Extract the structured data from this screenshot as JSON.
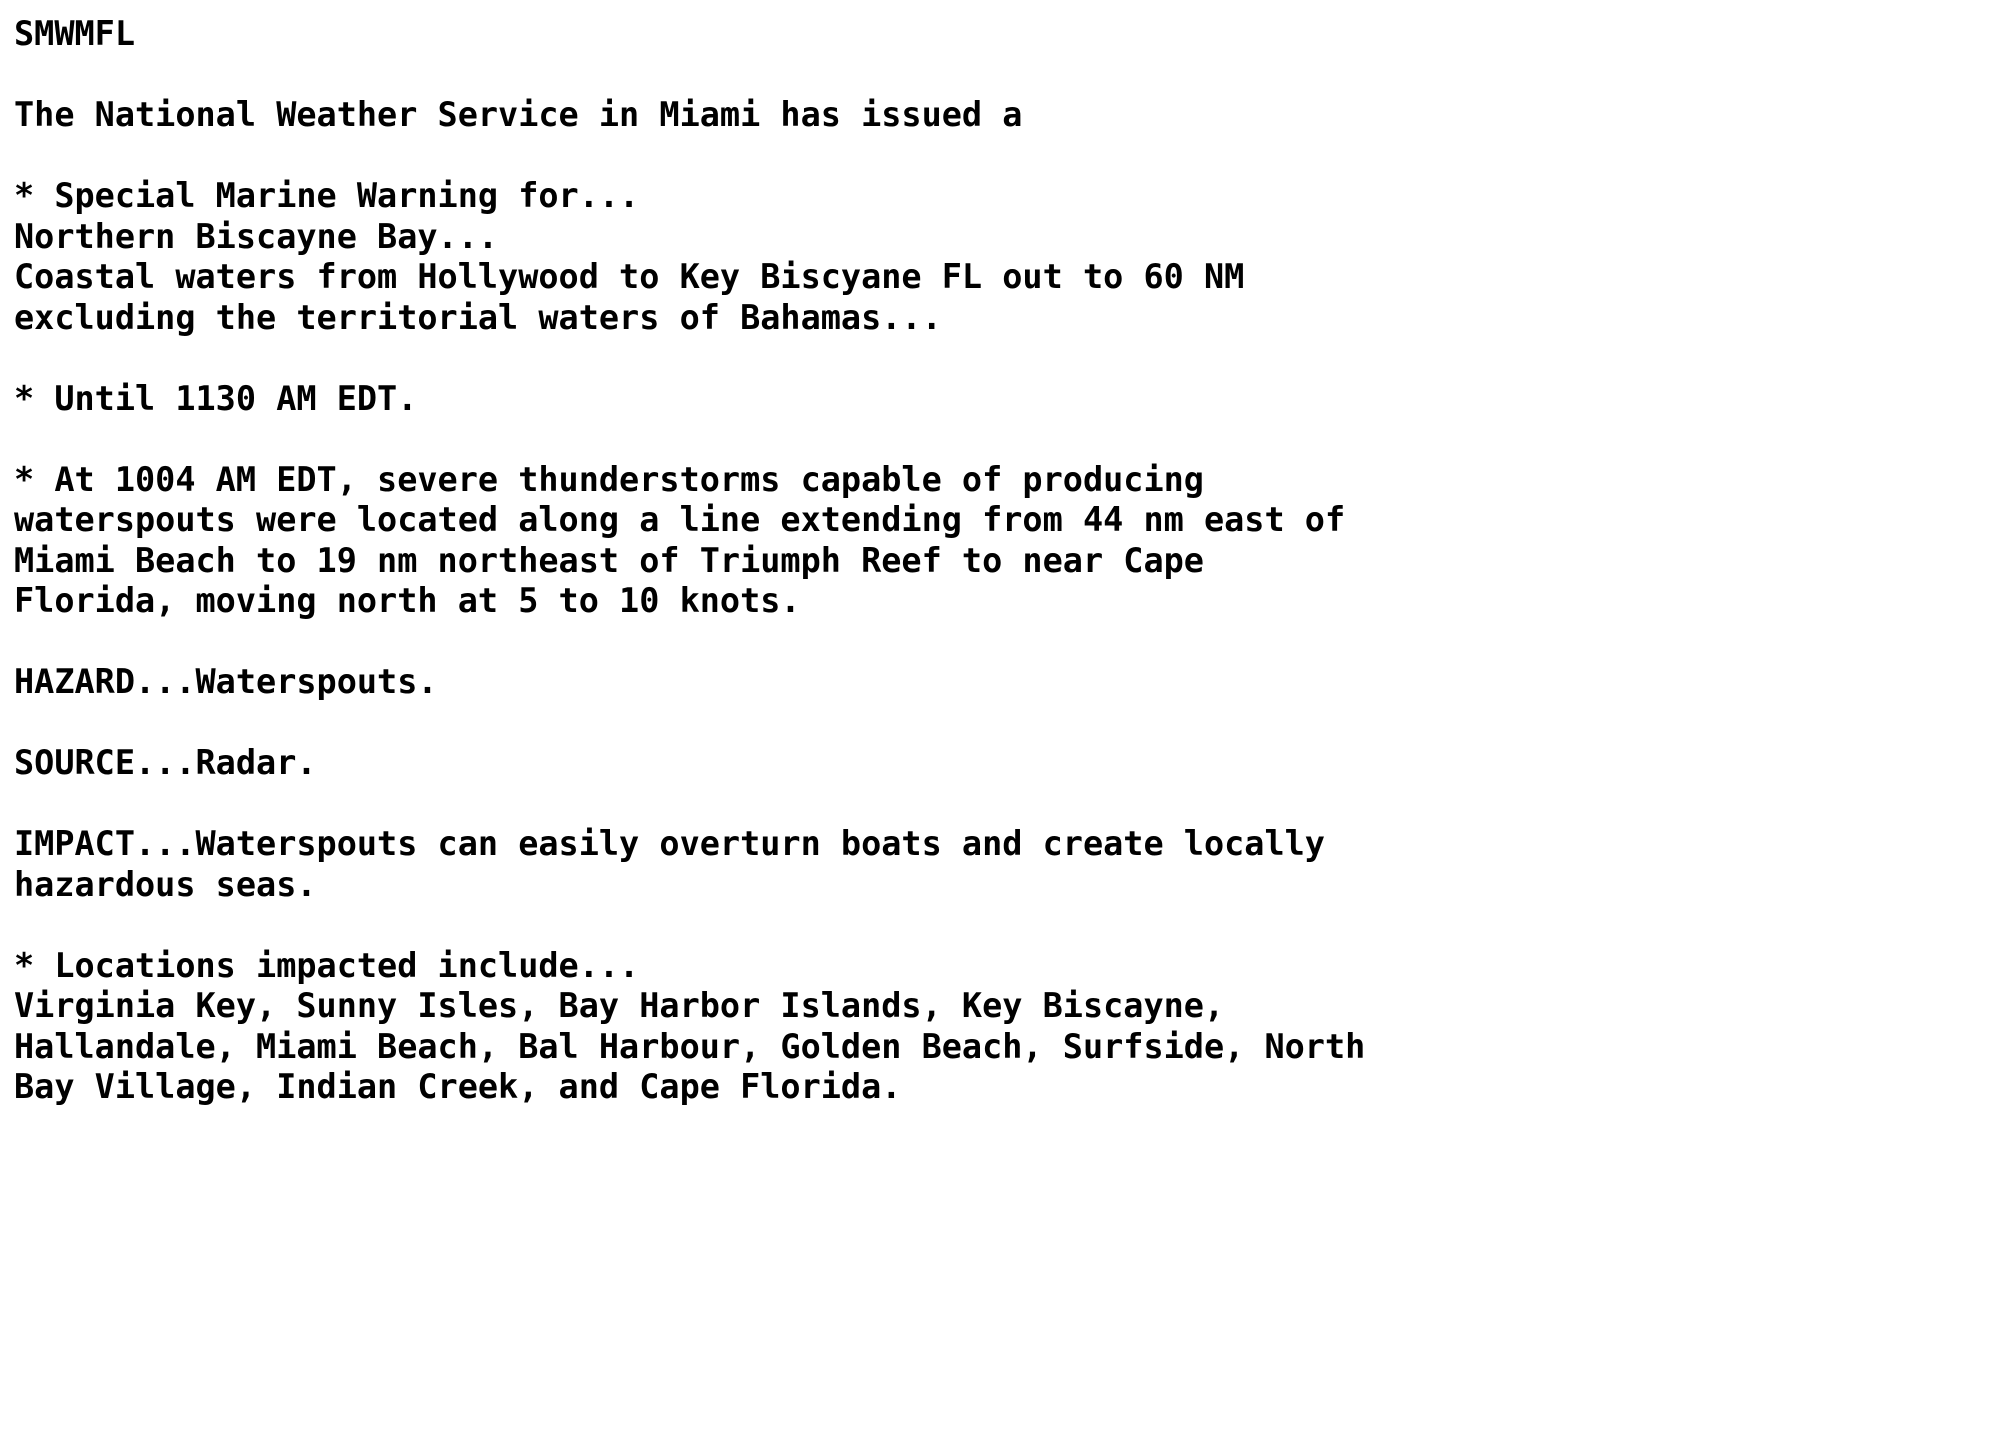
{
  "document": {
    "type": "plain-text-weather-bulletin",
    "product_id": "SMWMFL",
    "background_color": "#ffffff",
    "text_color": "#000000",
    "lines": [
      "SMWMFL",
      "",
      "The National Weather Service in Miami has issued a",
      "",
      "* Special Marine Warning for...",
      "Northern Biscayne Bay...",
      "Coastal waters from Hollywood to Key Biscyane FL out to 60 NM",
      "excluding the territorial waters of Bahamas...",
      "",
      "* Until 1130 AM EDT.",
      "",
      "* At 1004 AM EDT, severe thunderstorms capable of producing",
      "waterspouts were located along a line extending from 44 nm east of",
      "Miami Beach to 19 nm northeast of Triumph Reef to near Cape",
      "Florida, moving north at 5 to 10 knots.",
      "",
      "HAZARD...Waterspouts.",
      "",
      "SOURCE...Radar.",
      "",
      "IMPACT...Waterspouts can easily overturn boats and create locally",
      "hazardous seas.",
      "",
      "* Locations impacted include...",
      "Virginia Key, Sunny Isles, Bay Harbor Islands, Key Biscayne,",
      "Hallandale, Miami Beach, Bal Harbour, Golden Beach, Surfside, North",
      "Bay Village, Indian Creek, and Cape Florida."
    ],
    "sections": {
      "product_header": "SMWMFL",
      "issuing_office_statement": "The National Weather Service in Miami has issued a",
      "warning_type": "* Special Marine Warning for...",
      "areas": [
        "Northern Biscayne Bay...",
        "Coastal waters from Hollywood to Key Biscyane FL out to 60 NM",
        "excluding the territorial waters of Bahamas..."
      ],
      "expiration": "* Until 1130 AM EDT.",
      "expiration_time": "1130 AM EDT",
      "observation_time": "1004 AM EDT",
      "observation": [
        "* At 1004 AM EDT, severe thunderstorms capable of producing",
        "waterspouts were located along a line extending from 44 nm east of",
        "Miami Beach to 19 nm northeast of Triumph Reef to near Cape",
        "Florida, moving north at 5 to 10 knots."
      ],
      "hazard": "HAZARD...Waterspouts.",
      "source": "SOURCE...Radar.",
      "impact": [
        "IMPACT...Waterspouts can easily overturn boats and create locally",
        "hazardous seas."
      ],
      "locations_header": "* Locations impacted include...",
      "locations": [
        "Virginia Key, Sunny Isles, Bay Harbor Islands, Key Biscayne,",
        "Hallandale, Miami Beach, Bal Harbour, Golden Beach, Surfside, North",
        "Bay Village, Indian Creek, and Cape Florida."
      ],
      "location_names": [
        "Virginia Key",
        "Sunny Isles",
        "Bay Harbor Islands",
        "Key Biscayne",
        "Hallandale",
        "Miami Beach",
        "Bal Harbour",
        "Golden Beach",
        "Surfside",
        "North Bay Village",
        "Indian Creek",
        "Cape Florida"
      ],
      "storm_motion": "moving north at 5 to 10 knots",
      "distance_landmarks": [
        "44 nm east of Miami Beach",
        "19 nm northeast of Triumph Reef",
        "near Cape Florida"
      ]
    }
  }
}
